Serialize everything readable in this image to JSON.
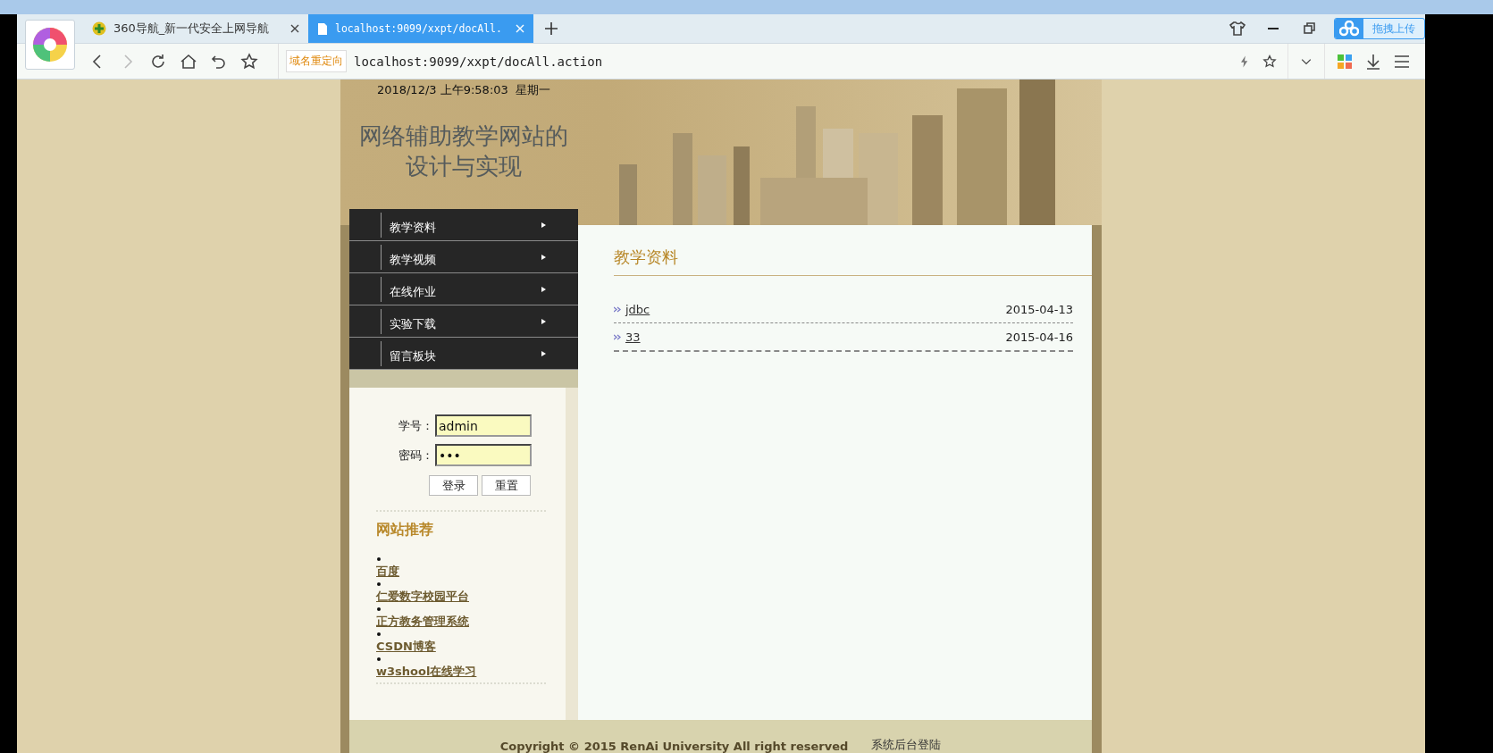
{
  "browser": {
    "tabs": [
      {
        "title": "360导航_新一代安全上网导航",
        "selected": false
      },
      {
        "title": "localhost:9099/xxpt/docAll.",
        "selected": true
      }
    ],
    "upload_button": "拖拽上传",
    "redirect_badge": "域名重定向",
    "url": "localhost:9099/xxpt/docAll.action"
  },
  "header": {
    "datetime": "2018/12/3 上午9:58:03  星期一",
    "title_lines": [
      "网络辅助教学网站的",
      "设计与实现"
    ]
  },
  "menu": [
    {
      "label": "教学资料"
    },
    {
      "label": "教学视频"
    },
    {
      "label": "在线作业"
    },
    {
      "label": "实验下载"
    },
    {
      "label": "留言板块"
    }
  ],
  "login": {
    "fields": [
      {
        "label": "学号：",
        "value": "admin"
      },
      {
        "label": "密码：",
        "value": "•••"
      }
    ],
    "buttons": [
      "登录",
      "重置"
    ]
  },
  "links": {
    "title": "网站推荐",
    "items": [
      "百度",
      "仁爱数字校园平台",
      "正方教务管理系统",
      "CSDN博客",
      "w3shool在线学习"
    ]
  },
  "content": {
    "title": "教学资料",
    "docs": [
      {
        "name": "jdbc",
        "date": "2015-04-13"
      },
      {
        "name": "33",
        "date": "2015-04-16"
      }
    ]
  },
  "footer": {
    "copyright": "Copyright © 2015 RenAi University All right reserved",
    "admin_link": "系统后台登陆"
  }
}
